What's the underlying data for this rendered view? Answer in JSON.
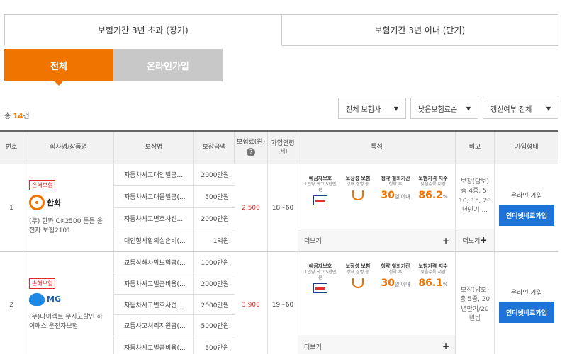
{
  "top_tabs": [
    "보험기간 3년 초과 (장기)",
    "보험기간 3년 이내 (단기)"
  ],
  "sub_tabs": [
    "전체",
    "온라인가입"
  ],
  "total": {
    "prefix": "총",
    "count": "14",
    "suffix": "건"
  },
  "filters": [
    "전체 보험사",
    "낮은보험료순",
    "갱신여부 전체"
  ],
  "headers": {
    "no": "번호",
    "name": "회사명/상품명",
    "coverage": "보장명",
    "amount": "보장금액",
    "premium": "보험료(원)",
    "age": "가입연령",
    "age_unit": "(세)",
    "features": "특성",
    "note": "비고",
    "join": "가입형태"
  },
  "rows": [
    {
      "no": "1",
      "badge": "손해보험",
      "company_short": "한화",
      "product": "(무) 한화 OK2500 든든 운전자 보험2101",
      "coverages": [
        {
          "name": "자동차사고대인벌금...",
          "amount": "2000만원"
        },
        {
          "name": "자동차사고대물벌금(...",
          "amount": "500만원"
        },
        {
          "name": "자동차사고변호사선...",
          "amount": "2000만원"
        },
        {
          "name": "대인형사합의실손비(...",
          "amount": "1억원"
        }
      ],
      "premium": "2,500",
      "age": "18~60",
      "features": {
        "f1_title": "예금자보호",
        "f1_sub": "1인당 최고 5천만원",
        "f2_title": "보장성 보험",
        "f2_sub": "상해,질병 등",
        "f3_title": "청약 철회기간",
        "f3_sub": "청약 후",
        "f3_value": "30",
        "f3_unit": "일 이내",
        "f4_title": "보험가격 지수",
        "f4_sub": "낮을수록 저렴",
        "f4_value": "86.2",
        "f4_unit": "%"
      },
      "note": "보장(담보) 총 4종. 5, 10, 15, 20년만기 ...",
      "join_type": "온라인 가입",
      "join_button": "인터넷바로가입"
    },
    {
      "no": "2",
      "badge": "손해보험",
      "company_short": "MG",
      "product": "(무)다이렉트 무사고할인 하이패스 운전자보험",
      "coverages": [
        {
          "name": "교통상해사망보험금(...",
          "amount": "1000만원"
        },
        {
          "name": "자동차사고벌금비용(...",
          "amount": "2000만원"
        },
        {
          "name": "자동차사고변호사선...",
          "amount": "2000만원"
        },
        {
          "name": "교통사고처리지원금(...",
          "amount": "5000만원"
        },
        {
          "name": "자동차사고벌금비용(...",
          "amount": "500만원"
        }
      ],
      "premium": "3,900",
      "age": "19~60",
      "features": {
        "f1_title": "예금자보호",
        "f1_sub": "1인당 최고 5천만원",
        "f2_title": "보장성 보험",
        "f2_sub": "상해,질병 등",
        "f3_title": "청약 철회기간",
        "f3_sub": "청약 후",
        "f3_value": "30",
        "f3_unit": "일 이내",
        "f4_title": "보험가격 지수",
        "f4_sub": "낮을수록 저렴",
        "f4_value": "86.1",
        "f4_unit": "%"
      },
      "note": "보장(담보) 총 5종, 20년만기/20년납",
      "join_type": "온라인 가입",
      "join_button": "인터넷바로가입"
    }
  ],
  "more_label": "더보기",
  "plus": "+",
  "help_icon": "?",
  "colors": {
    "accent": "#f07400",
    "button": "#1e73d8",
    "premium": "#e02a2a"
  }
}
